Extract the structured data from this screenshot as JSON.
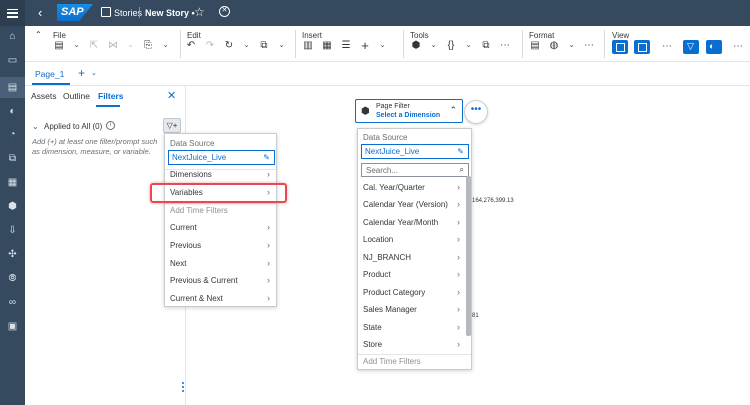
{
  "shell": {
    "stories_label": "Stories",
    "story_title": "New Story",
    "modified_marker": "•",
    "logo_text": "SAP"
  },
  "toolbar": {
    "groups": {
      "file": "File",
      "edit": "Edit",
      "insert": "Insert",
      "tools": "Tools",
      "format": "Format",
      "view": "View"
    }
  },
  "page_tab": {
    "label": "Page_1"
  },
  "side_panel": {
    "tabs": [
      "Assets",
      "Outline",
      "Filters"
    ],
    "active_tab": "Filters",
    "applied_label": "Applied to All (0)",
    "hint": "Add (+) at least one filter/prompt such as dimension, measure, or variable."
  },
  "left_menu": {
    "data_source_header": "Data Source",
    "data_source_value": "NextJuice_Live",
    "items": [
      {
        "label": "Dimensions",
        "arrow": true,
        "disabled": false
      },
      {
        "label": "Variables",
        "arrow": true,
        "disabled": false
      },
      {
        "label": "Add Time Filters",
        "arrow": false,
        "disabled": true
      },
      {
        "label": "Current",
        "arrow": true,
        "disabled": false
      },
      {
        "label": "Previous",
        "arrow": true,
        "disabled": false
      },
      {
        "label": "Next",
        "arrow": true,
        "disabled": false
      },
      {
        "label": "Previous & Current",
        "arrow": true,
        "disabled": false
      },
      {
        "label": "Current & Next",
        "arrow": true,
        "disabled": false
      }
    ]
  },
  "page_filter": {
    "title": "Page Filter",
    "subtitle": "Select a Dimension"
  },
  "right_menu": {
    "data_source_header": "Data Source",
    "data_source_value": "NextJuice_Live",
    "search_placeholder": "Search...",
    "items": [
      "Cal. Year/Quarter",
      "Calendar Year (Version)",
      "Calendar Year/Month",
      "Location",
      "NJ_BRANCH",
      "Product",
      "Product Category",
      "Sales Manager",
      "State",
      "Store"
    ],
    "footer": "Add Time Filters"
  },
  "background_text": {
    "value1": "164,276,399.13",
    "value2": "81"
  },
  "colors": {
    "shell": "#354a5f",
    "accent": "#0a6ed1",
    "highlight": "#e8484f"
  }
}
